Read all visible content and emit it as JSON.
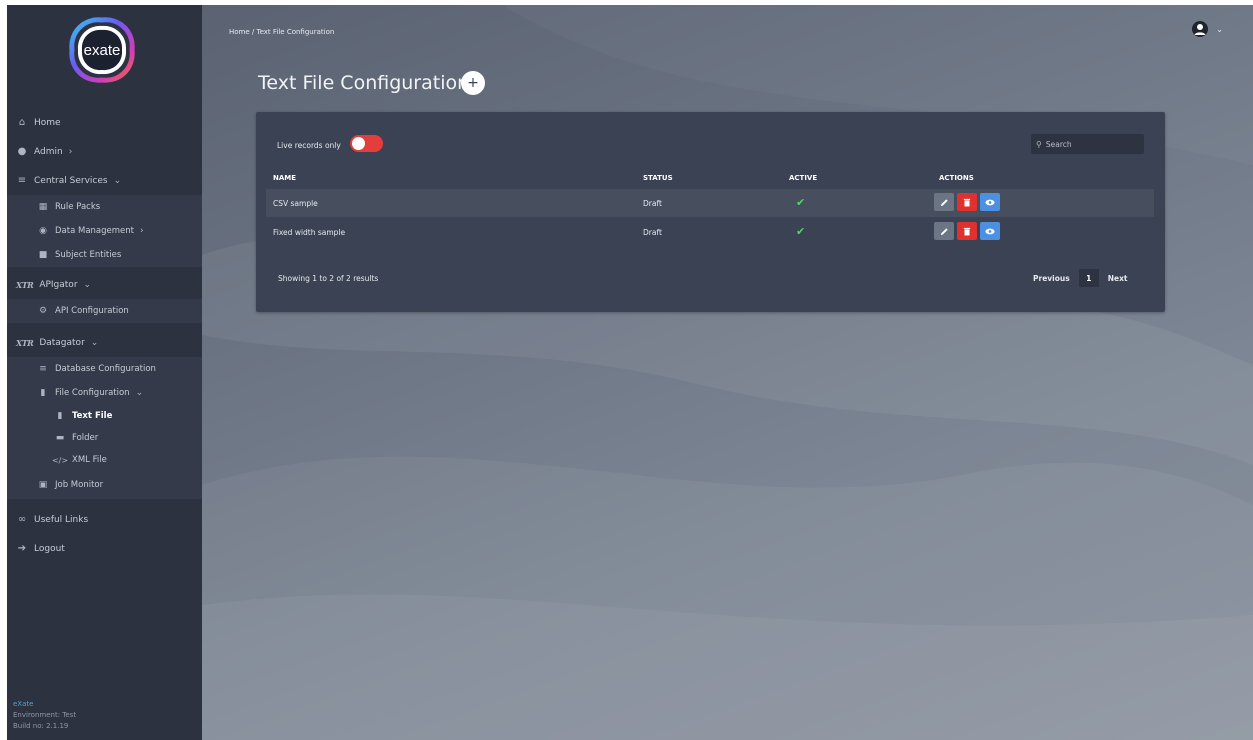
{
  "app": {
    "logo_text": "exate"
  },
  "sidebar": {
    "home": "Home",
    "admin": "Admin",
    "central_services": "Central Services",
    "rule_packs": "Rule Packs",
    "data_management": "Data Management",
    "subject_entities": "Subject Entities",
    "apigator_brand": "XTR",
    "apigator": "APIgator",
    "api_configuration": "API Configuration",
    "datagator_brand": "XTR",
    "datagator": "Datagator",
    "database_configuration": "Database Configuration",
    "file_configuration": "File Configuration",
    "text_file": "Text File",
    "folder": "Folder",
    "xml_file": "XML File",
    "job_monitor": "Job Monitor",
    "useful_links": "Useful Links",
    "logout": "Logout"
  },
  "footer": {
    "brand": "eXate",
    "environment": "Environment: Test",
    "build": "Build no: 2.1.19"
  },
  "header": {
    "breadcrumb_home": "Home",
    "breadcrumb_sep": "/",
    "breadcrumb_current": "Text File Configuration",
    "title": "Text File Configuration",
    "add_label": "+"
  },
  "toolbar": {
    "live_records_label": "Live records only",
    "live_records_on": true,
    "search_placeholder": "Search"
  },
  "table": {
    "columns": [
      "NAME",
      "STATUS",
      "ACTIVE",
      "ACTIONS"
    ],
    "rows": [
      {
        "name": "CSV sample",
        "status": "Draft",
        "active": true
      },
      {
        "name": "Fixed width sample",
        "status": "Draft",
        "active": true
      }
    ]
  },
  "pagination": {
    "summary": "Showing 1 to 2 of 2 results",
    "previous": "Previous",
    "page": "1",
    "next": "Next"
  },
  "colors": {
    "sidebar_bg": "#2c3240",
    "card_bg": "#3b4253",
    "toggle_on": "#e33d3d",
    "delete": "#e03131",
    "view": "#4d8fe0",
    "check": "#4cd964"
  },
  "icons": {
    "home": "home-icon",
    "admin": "users-icon",
    "central_services": "layers-icon",
    "edit": "pencil-icon",
    "delete": "trash-icon",
    "view": "eye-icon"
  }
}
